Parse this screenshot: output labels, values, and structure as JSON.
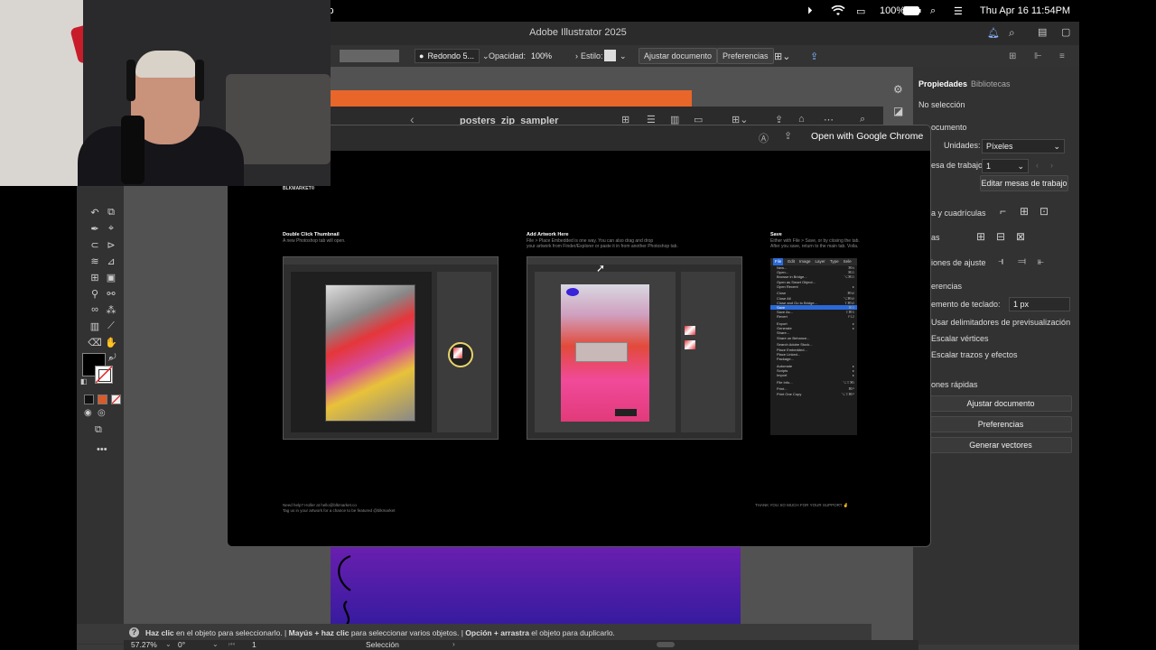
{
  "menubar": {
    "battery": "100%",
    "datetime": "Thu Apr 16  11:54PM"
  },
  "illustrator": {
    "title": "Adobe Illustrator 2025",
    "control_bar": {
      "brush": "Redondo 5...",
      "opacity_label": "Opacidad:",
      "opacity_value": "100%",
      "style_label": "Estilo:",
      "ajustar_button": "Ajustar documento",
      "preferencias_button": "Preferencias"
    },
    "document_tab": "posters_zip_sampler",
    "properties_panel": {
      "tab_properties": "Propiedades",
      "tab_libraries": "Bibliotecas",
      "no_selection": "No selección",
      "documento": "ocumento",
      "unidades_label": "Unidades:",
      "unidades_value": "Píxeles",
      "mesa_label": "esa de trabajo:",
      "mesa_value": "1",
      "editar_button": "Editar mesas de trabajo",
      "reglas": "a y cuadrículas",
      "guias": "as",
      "ajuste": "iones de ajuste",
      "preferencias_section": "erencias",
      "incremento_label": "emento de teclado:",
      "incremento_value": "1 px",
      "check_delimitadores": "Usar delimitadores de previsualización",
      "check_vertices": "Escalar vértices",
      "check_trazos": "Escalar trazos y efectos",
      "acciones_rapidas": "ones rápidas",
      "quick_ajustar": "Ajustar documento",
      "quick_preferencias": "Preferencias",
      "quick_generar": "Generar vectores"
    },
    "status_hint": {
      "p1": "Haz clic",
      "p2": " en el objeto para seleccionarlo.  |  ",
      "p3": "Mayús + haz clic",
      "p4": " para seleccionar varios objetos.  |  ",
      "p5": "Opción + arrastra",
      "p6": " el objeto para duplicarlo."
    },
    "bottom_bar": {
      "zoom": "57.27%",
      "rotation": "0°",
      "artboard": "1",
      "tool_name": "Selección"
    },
    "colors": {
      "fill": "#000000",
      "stroke": "#ffffff",
      "accent_orange": "#e8662a",
      "gradient_top": "#6a1fb0",
      "gradient_bottom": "#2a1a9a"
    }
  },
  "preview": {
    "open_with_button": "Open with Google Chrome",
    "brand": "BLKMARKET®",
    "step1": {
      "title": "Double Click Thumbnail",
      "desc": "A new Photoshop tab will open."
    },
    "step2": {
      "title": "Add Artwork Here",
      "desc1": "File > Place Embedded is one way. You can also drag and drop",
      "desc2": "your artwork from Finder/Explorer or paste it in from another Photoshop tab."
    },
    "step3": {
      "title": "Save",
      "desc1": "Either with File > Save, or by closing the tab.",
      "desc2": "After you save, return to the main tab. Voila."
    },
    "ps_menu": {
      "bar": [
        "File",
        "Edit",
        "Image",
        "Layer",
        "Type",
        "Sele"
      ],
      "items": [
        {
          "label": "New...",
          "sc": "⌘N"
        },
        {
          "label": "Open...",
          "sc": "⌘O"
        },
        {
          "label": "Browse in Bridge...",
          "sc": "⌥⌘O"
        },
        {
          "label": "Open as Smart Object...",
          "sc": ""
        },
        {
          "label": "Open Recent",
          "sc": "▸"
        },
        {
          "label": "",
          "sc": ""
        },
        {
          "label": "Close",
          "sc": "⌘W"
        },
        {
          "label": "Close All",
          "sc": "⌥⌘W"
        },
        {
          "label": "Close and Go to Bridge...",
          "sc": "⇧⌘W"
        },
        {
          "label": "Save",
          "sc": "⌘S"
        },
        {
          "label": "Save As...",
          "sc": "⇧⌘S"
        },
        {
          "label": "Revert",
          "sc": "F12"
        },
        {
          "label": "",
          "sc": ""
        },
        {
          "label": "Export",
          "sc": "▸"
        },
        {
          "label": "Generate",
          "sc": "▸"
        },
        {
          "label": "Share...",
          "sc": ""
        },
        {
          "label": "Share on Behance...",
          "sc": ""
        },
        {
          "label": "",
          "sc": ""
        },
        {
          "label": "Search Adobe Stock...",
          "sc": ""
        },
        {
          "label": "Place Embedded...",
          "sc": ""
        },
        {
          "label": "Place Linked...",
          "sc": ""
        },
        {
          "label": "Package...",
          "sc": ""
        },
        {
          "label": "",
          "sc": ""
        },
        {
          "label": "Automate",
          "sc": "▸"
        },
        {
          "label": "Scripts",
          "sc": "▸"
        },
        {
          "label": "Import",
          "sc": "▸"
        },
        {
          "label": "",
          "sc": ""
        },
        {
          "label": "File Info...",
          "sc": "⌥⇧⌘I"
        },
        {
          "label": "",
          "sc": ""
        },
        {
          "label": "Print...",
          "sc": "⌘P"
        },
        {
          "label": "Print One Copy",
          "sc": "⌥⇧⌘P"
        }
      ]
    },
    "footer_left1": "Need help? Holler at hello@blkmarket.co",
    "footer_left2": "Tag us in your artwork for a chance to be featured @blkmarket",
    "footer_right": "THANK YOU SO MUCH FOR YOUR SUPPORT ✌"
  }
}
